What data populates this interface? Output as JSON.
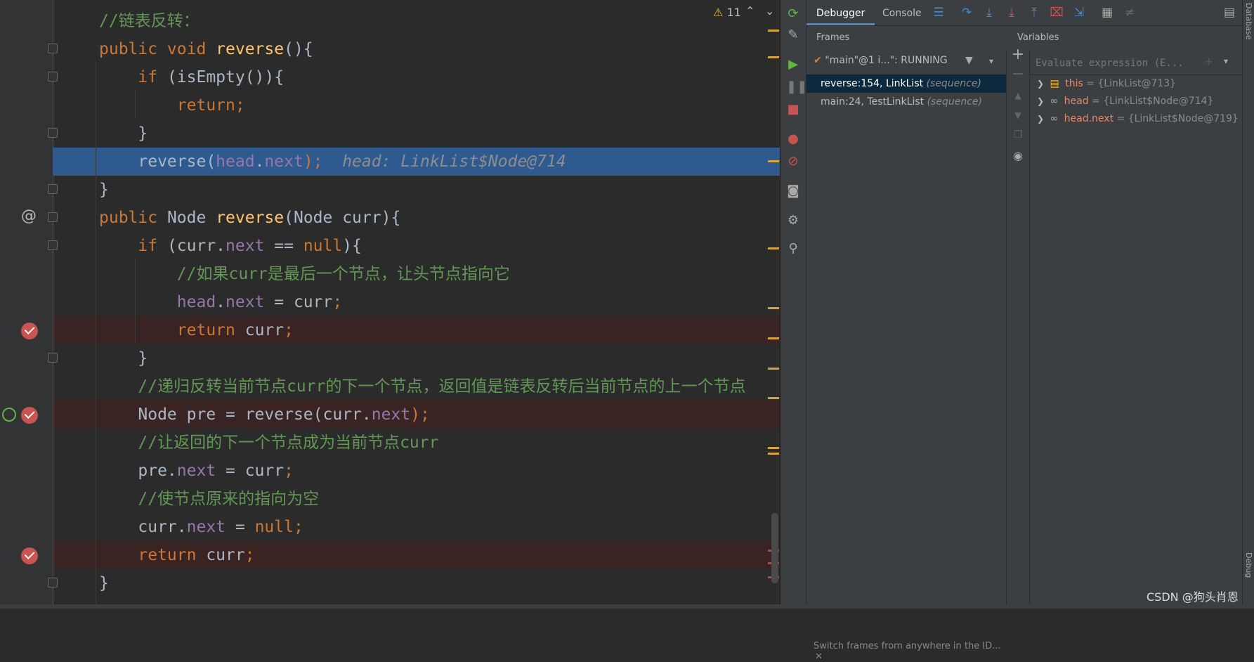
{
  "editor": {
    "warnings": {
      "count": "11"
    },
    "lines": [
      {
        "tokens": [
          {
            "t": "//链表反转：",
            "c": "cm"
          }
        ]
      },
      {
        "tokens": [
          {
            "t": "public void ",
            "c": "kw"
          },
          {
            "t": "reverse",
            "c": "fn"
          },
          {
            "t": "(){",
            "c": ""
          }
        ]
      },
      {
        "tokens": [
          {
            "t": "    if ",
            "c": "kw"
          },
          {
            "t": "(isEmpty()){",
            "c": ""
          }
        ]
      },
      {
        "tokens": [
          {
            "t": "        return;",
            "c": "kw"
          }
        ]
      },
      {
        "tokens": [
          {
            "t": "    }",
            "c": ""
          }
        ]
      },
      {
        "tokens": [
          {
            "t": "    reverse(",
            "c": ""
          },
          {
            "t": "head",
            "c": "fld"
          },
          {
            "t": ".",
            "c": ""
          },
          {
            "t": "next",
            "c": "fld"
          },
          {
            "t": ");",
            "c": "kw"
          },
          {
            "t": "  head: LinkList$Node@714",
            "c": "inl"
          }
        ],
        "state": "current"
      },
      {
        "tokens": [
          {
            "t": "}",
            "c": ""
          }
        ]
      },
      {
        "tokens": [
          {
            "t": "public ",
            "c": "kw"
          },
          {
            "t": "Node ",
            "c": ""
          },
          {
            "t": "reverse",
            "c": "fn"
          },
          {
            "t": "(Node curr){",
            "c": ""
          }
        ]
      },
      {
        "tokens": [
          {
            "t": "    if ",
            "c": "kw"
          },
          {
            "t": "(curr.",
            "c": ""
          },
          {
            "t": "next",
            "c": "fld"
          },
          {
            "t": " == ",
            "c": ""
          },
          {
            "t": "null",
            "c": "kw"
          },
          {
            "t": "){",
            "c": ""
          }
        ]
      },
      {
        "tokens": [
          {
            "t": "        //如果curr是最后一个节点，让头节点指向它",
            "c": "cm"
          }
        ]
      },
      {
        "tokens": [
          {
            "t": "        ",
            "c": ""
          },
          {
            "t": "head",
            "c": "fld"
          },
          {
            "t": ".",
            "c": ""
          },
          {
            "t": "next",
            "c": "fld"
          },
          {
            "t": " = curr",
            "c": ""
          },
          {
            "t": ";",
            "c": "kw"
          }
        ]
      },
      {
        "tokens": [
          {
            "t": "        return ",
            "c": "kw"
          },
          {
            "t": "curr",
            "c": ""
          },
          {
            "t": ";",
            "c": "kw"
          }
        ],
        "state": "bp"
      },
      {
        "tokens": [
          {
            "t": "    }",
            "c": ""
          }
        ]
      },
      {
        "tokens": [
          {
            "t": "    //递归反转当前节点curr的下一个节点，返回值是链表反转后当前节点的上一个节点",
            "c": "cm"
          }
        ]
      },
      {
        "tokens": [
          {
            "t": "    Node pre = reverse(curr.",
            "c": ""
          },
          {
            "t": "next",
            "c": "fld"
          },
          {
            "t": ");",
            "c": "kw"
          }
        ],
        "state": "bp"
      },
      {
        "tokens": [
          {
            "t": "    //让返回的下一个节点成为当前节点curr",
            "c": "cm"
          }
        ]
      },
      {
        "tokens": [
          {
            "t": "    pre.",
            "c": ""
          },
          {
            "t": "next",
            "c": "fld"
          },
          {
            "t": " = curr",
            "c": ""
          },
          {
            "t": ";",
            "c": "kw"
          }
        ]
      },
      {
        "tokens": [
          {
            "t": "    //使节点原来的指向为空",
            "c": "cm"
          }
        ]
      },
      {
        "tokens": [
          {
            "t": "    curr.",
            "c": ""
          },
          {
            "t": "next",
            "c": "fld"
          },
          {
            "t": " = ",
            "c": ""
          },
          {
            "t": "null",
            "c": "kw"
          },
          {
            "t": ";",
            "c": "kw"
          }
        ]
      },
      {
        "tokens": [
          {
            "t": "    return ",
            "c": "kw"
          },
          {
            "t": "curr",
            "c": ""
          },
          {
            "t": ";",
            "c": "kw"
          }
        ],
        "state": "bp"
      },
      {
        "tokens": [
          {
            "t": "}",
            "c": ""
          }
        ]
      }
    ]
  },
  "toolbar": {
    "tabs": [
      {
        "label": "Debugger",
        "active": true
      },
      {
        "label": "Console",
        "active": false
      }
    ]
  },
  "frames": {
    "header": "Frames",
    "thread": "\"main\"@1 i...\": RUNNING",
    "items": [
      {
        "label": "reverse:154, LinkList ",
        "kind": "(sequence)",
        "selected": true
      },
      {
        "label": "main:24, TestLinkList ",
        "kind": "(sequence)",
        "selected": false
      }
    ],
    "hint": "Switch frames from anywhere in the ID..."
  },
  "variables": {
    "header": "Variables",
    "eval_placeholder": "Evaluate expression (E...",
    "items": [
      {
        "name": "this",
        "value": " = {LinkList@713}",
        "icon": "field-icon"
      },
      {
        "name": "head",
        "value": " = {LinkList$Node@714}",
        "icon": "watch-icon"
      },
      {
        "name": "head.next",
        "value": " = {LinkList$Node@719}",
        "icon": "watch-icon"
      }
    ]
  },
  "watermark": "CSDN @狗头肖恩",
  "rail": {
    "top": "Database",
    "bottom": "Debug"
  }
}
